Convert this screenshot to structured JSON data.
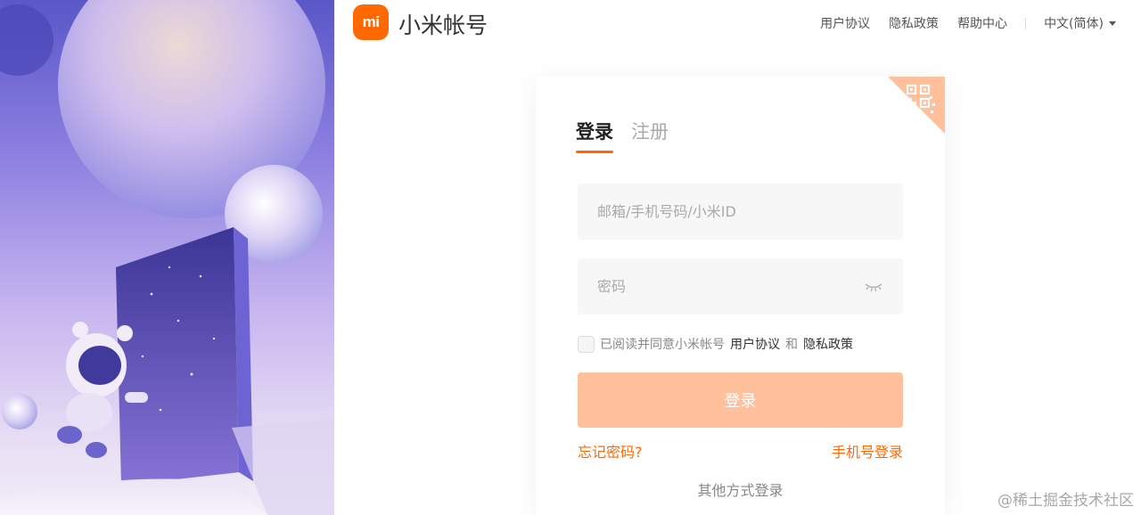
{
  "header": {
    "logo_text": "mi",
    "brand": "小米帐号",
    "nav": [
      "用户协议",
      "隐私政策",
      "帮助中心"
    ],
    "language": "中文(简体)"
  },
  "colors": {
    "accent": "#ff6900",
    "button_disabled": "#ffc09c",
    "field_bg": "#f7f7f7"
  },
  "login": {
    "tabs": [
      "登录",
      "注册"
    ],
    "active_tab": "登录",
    "account_placeholder": "邮箱/手机号码/小米ID",
    "password_placeholder": "密码",
    "agree_prefix": "已阅读并同意小米帐号",
    "agree_terms": "用户协议",
    "agree_and": "和",
    "agree_privacy": "隐私政策",
    "submit": "登录",
    "forgot": "忘记密码?",
    "phone_login": "手机号登录",
    "other_methods": "其他方式登录"
  },
  "icons": [
    "qr-code-icon",
    "eye-closed-icon",
    "chevron-down-icon"
  ],
  "watermark": "@稀土掘金技术社区"
}
